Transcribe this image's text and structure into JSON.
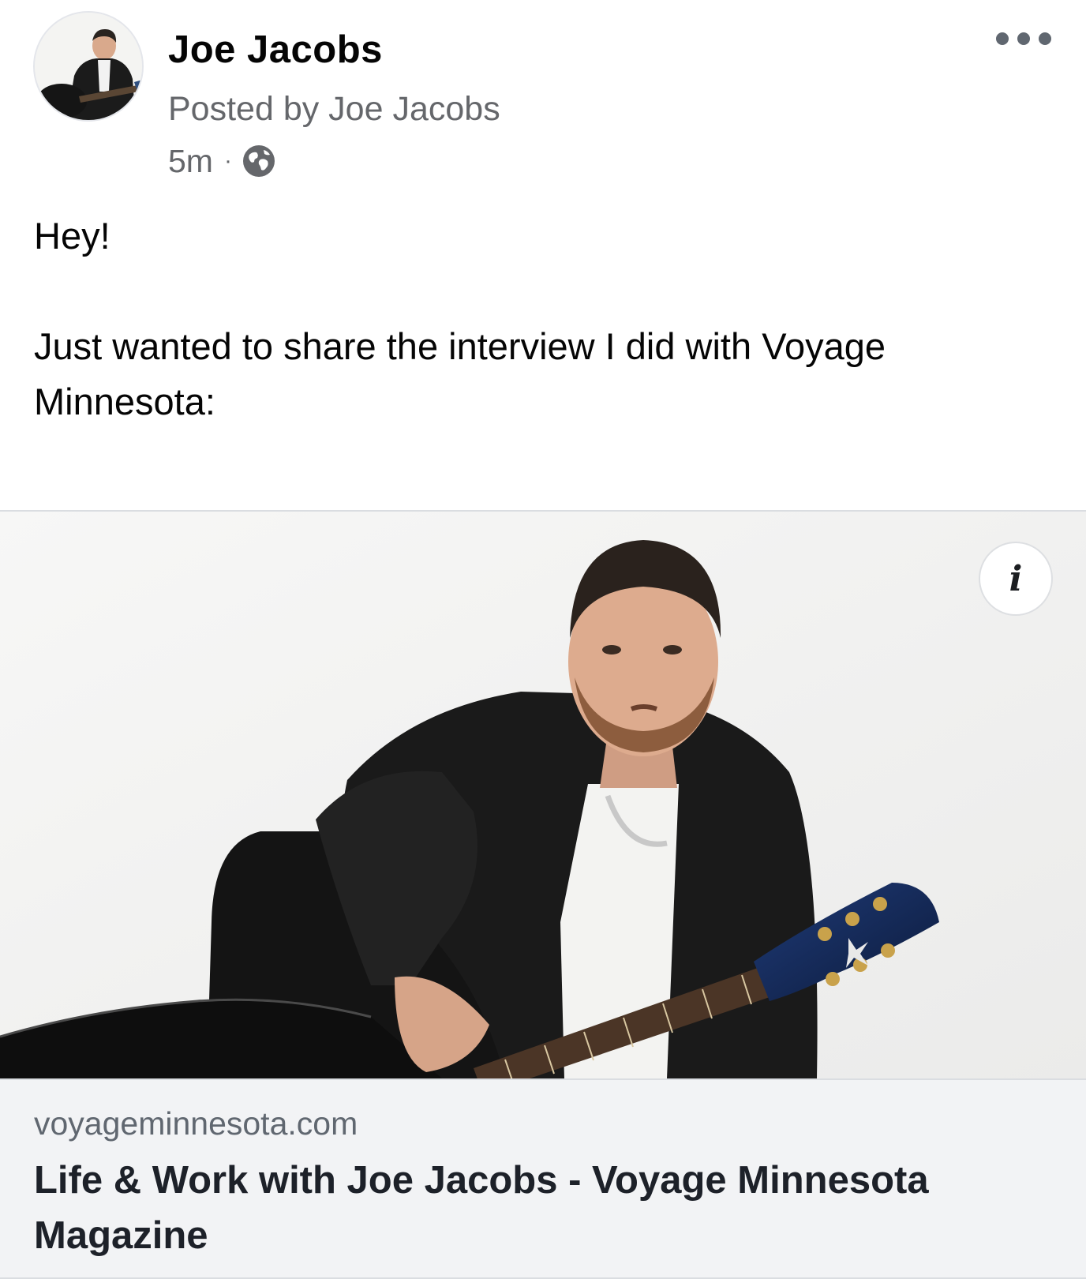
{
  "post": {
    "author": "Joe Jacobs",
    "posted_by": "Posted by Joe Jacobs",
    "time": "5m",
    "separator": "·",
    "audience_icon": "globe-icon",
    "menu_icon": "more-options-icon",
    "text": {
      "greeting": "Hey!",
      "body": "Just wanted to share the interview I did with Voyage Minnesota:"
    }
  },
  "link_preview": {
    "info_icon_glyph": "i",
    "domain": "voyageminnesota.com",
    "title": "Life & Work with Joe Jacobs - Voyage Minnesota Magazine"
  },
  "colors": {
    "secondary_text": "#65676b",
    "card_background": "#f2f3f5",
    "border": "#dadde1"
  }
}
